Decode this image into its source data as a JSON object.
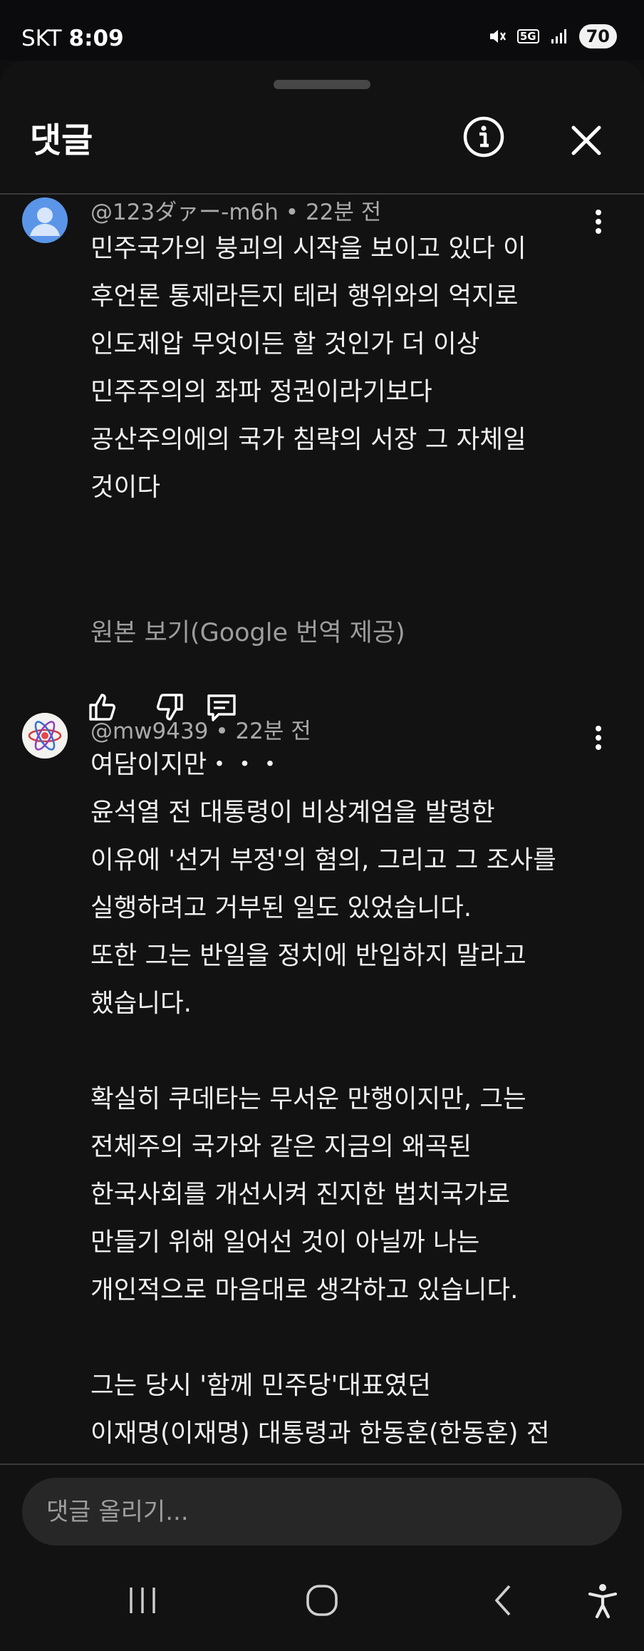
{
  "status_bar": {
    "carrier": "SKT",
    "time": "8:09",
    "network": "5G",
    "battery": "70"
  },
  "sheet": {
    "title": "댓글"
  },
  "comments": [
    {
      "author": "@123ダァー-m6h",
      "time": "22분 전",
      "text": "민주국가의 붕괴의 시작을 보이고 있다 이\n후언론 통제라든지 테러 행위와의 억지로\n인도제압 무엇이든 할 것인가 더 이상\n민주주의의 좌파 정권이라기보다\n공산주의에의 국가 침략의 서장 그 자체일\n것이다",
      "translate_label": "원본 보기(Google 번역 제공)"
    },
    {
      "author": "@mw9439",
      "time": "22분 전",
      "text": "여담이지만・・・\n윤석열 전 대통령이 비상계엄을 발령한\n이유에 '선거 부정'의 혐의, 그리고 그 조사를\n실행하려고 거부된 일도 있었습니다.\n또한 그는 반일을 정치에 반입하지 말라고\n했습니다.\n\n확실히 쿠데타는 무서운 만행이지만, 그는\n전체주의 국가와 같은 지금의 왜곡된\n한국사회를 개선시켜 진지한 법치국가로\n만들기 위해 일어선 것이 아닐까 나는\n개인적으로 마음대로 생각하고 있습니다.\n\n그는 당시 '함께 민주당'대표였던\n이재명(이재명) 대통령과 한동훈(한동훈) 전"
    }
  ],
  "composer": {
    "placeholder": "댓글 올리기..."
  }
}
